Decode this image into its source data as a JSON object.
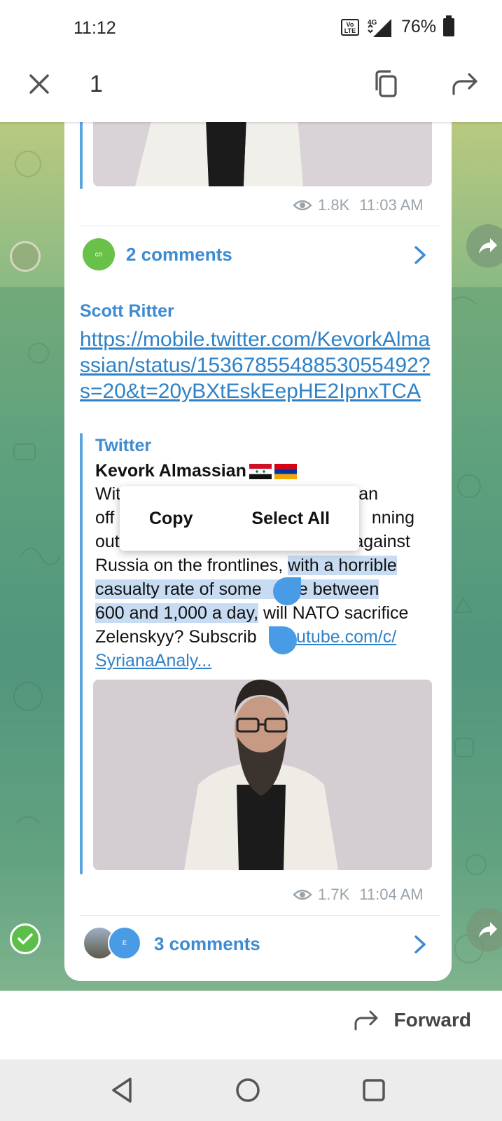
{
  "status_bar": {
    "time": "11:12",
    "network": "4G",
    "battery": "76%"
  },
  "action_bar": {
    "selected_count": "1"
  },
  "messages": [
    {
      "views": "1.8K",
      "time": "11:03 AM",
      "comments_label": "2 comments",
      "avatar_initials": "cn"
    },
    {
      "sender": "Scott Ritter",
      "link": "https://mobile.twitter.com/KevorkAlmassian/status/1536785548853055492?s=20&t=20yBXtEskEepHE2IpnxTCA",
      "preview": {
        "site": "Twitter",
        "title": "Kevork Almassian",
        "body_part1": "Wit",
        "body_part1b": "an",
        "body_part2": "off",
        "body_part2b": "nning",
        "body_part3": "out",
        "body_part3b": "against",
        "body_part4": "Russia on the frontlines, ",
        "body_highlight1": "with a horrible",
        "body_highlight2": "casualty rate of some",
        "body_highlight2b": "ere between",
        "body_highlight3": "600 and 1,000 a day,",
        "body_part5": " will NATO sacrifice",
        "body_part6": "Zelenskyy? Subscrib",
        "body_link1": "youtube.com/c/",
        "body_link2": "SyrianaAnaly..."
      },
      "views": "1.7K",
      "time": "11:04 AM",
      "comments_label": "3 comments",
      "avatar_initials": "E"
    }
  ],
  "context_menu": {
    "copy": "Copy",
    "select_all": "Select All"
  },
  "bottom_bar": {
    "forward_label": "Forward"
  }
}
